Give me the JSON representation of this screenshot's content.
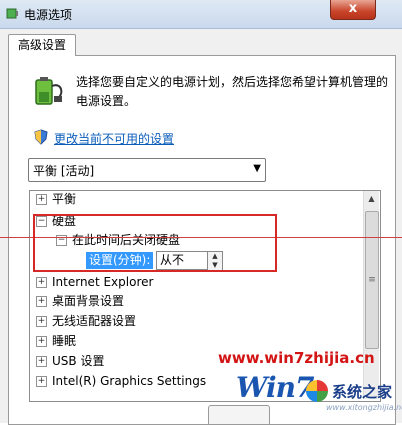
{
  "window": {
    "title": "电源选项",
    "close_glyph": "x"
  },
  "tab": {
    "label": "高级设置"
  },
  "header": {
    "description": "选择您要自定义的电源计划，然后选择您希望计算机管理的电源设置。"
  },
  "change_link": {
    "label": "更改当前不可用的设置"
  },
  "plan_select": {
    "value": "平衡 [活动]"
  },
  "tree": {
    "items": [
      {
        "label": "平衡",
        "toggle": "+"
      },
      {
        "label": "硬盘",
        "toggle": "−"
      },
      {
        "label": "在此时间后关闭硬盘",
        "toggle": "−"
      },
      {
        "label": "Internet Explorer",
        "toggle": "+"
      },
      {
        "label": "桌面背景设置",
        "toggle": "+"
      },
      {
        "label": "无线适配器设置",
        "toggle": "+"
      },
      {
        "label": "睡眠",
        "toggle": "+"
      },
      {
        "label": "USB 设置",
        "toggle": "+"
      },
      {
        "label": "Intel(R) Graphics Settings",
        "toggle": "+"
      }
    ],
    "setting": {
      "label": "设置(分钟):",
      "value": "从不"
    }
  },
  "watermark": {
    "url": "www.win7zhijia.cn",
    "brand": "Win7",
    "site_name": "系统之家",
    "domain": "www.xitongzhijia.net"
  },
  "colors": {
    "highlight": "#3399ff",
    "annotation_red": "#d72828",
    "link": "#0a5cba"
  }
}
